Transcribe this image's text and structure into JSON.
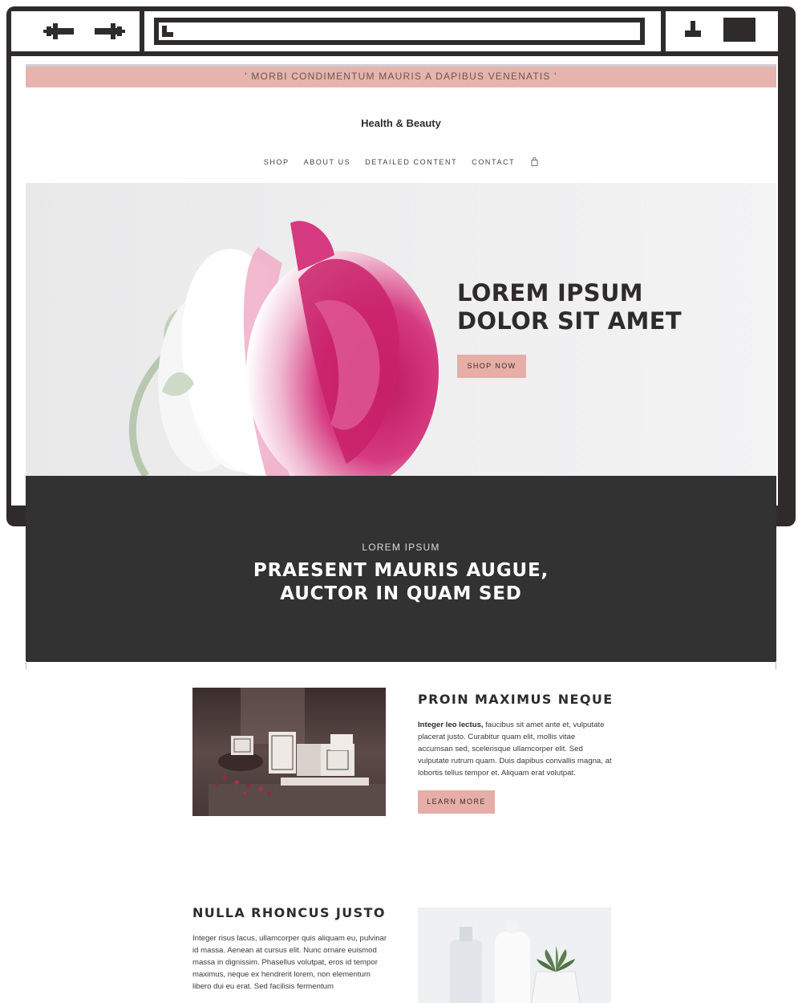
{
  "browser": {
    "icons": {
      "back": "arrow-left-icon",
      "forward": "arrow-right-icon",
      "url": "page-icon",
      "minimize": "minimize-icon",
      "maximize": "maximize-icon"
    },
    "frame_color": "#2f2b2b"
  },
  "site": {
    "announcement": "' MORBI CONDIMENTUM MAURIS A DAPIBUS VENENATIS '",
    "brand": "Health & Beauty",
    "nav": [
      {
        "label": "SHOP"
      },
      {
        "label": "ABOUT US"
      },
      {
        "label": "DETAILED CONTENT"
      },
      {
        "label": "CONTACT"
      }
    ],
    "cart_icon": "shopping-bag-icon",
    "accent": "#e6aea6"
  },
  "hero": {
    "title_line1": "LOREM IPSUM",
    "title_line2": "DOLOR SIT AMET",
    "button": "SHOP NOW"
  },
  "banner": {
    "kicker": "LOREM IPSUM",
    "title_line1": "PRAESENT MAURIS AUGUE,",
    "title_line2": "AUCTOR IN QUAM SED",
    "background": "#333232"
  },
  "feature1": {
    "title": "PROIN MAXIMUS NEQUE",
    "lead": "Integer leo lectus,",
    "body": " faucibus sit amet ante et, vulputate placerat justo. Curabitur quam elit, mollis vitae accumsan sed, scelerisque ullamcorper elit. Sed vulputate rutrum quam. Duis dapibus convallis magna, at lobortis tellus tempor et. Aliquam erat volutpat.",
    "button": "LEARN MORE"
  },
  "feature2": {
    "title": "NULLA RHONCUS JUSTO",
    "body": "Integer risus lacus, ullamcorper quis aliquam eu, pulvinar id massa. Aenean at cursus elit. Nunc ornare euismod massa in dignissim. Phasellus volutpat, eros id tempor maximus, neque ex hendrerit lorem, non elementum libero dui eu erat. Sed facilisis fermentum"
  }
}
